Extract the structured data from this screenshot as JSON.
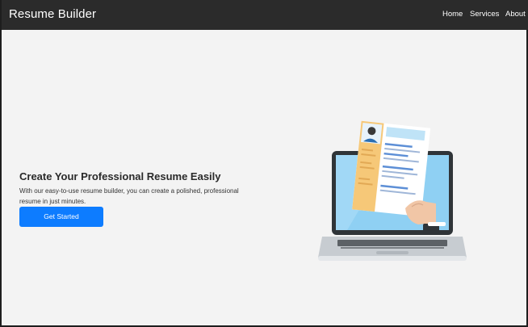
{
  "navbar": {
    "brand": "Resume Builder",
    "links": [
      {
        "label": "Home"
      },
      {
        "label": "Services"
      },
      {
        "label": "About"
      }
    ]
  },
  "hero": {
    "title": "Create Your Professional Resume Easily",
    "description": "With our easy-to-use resume builder, you can create a polished, professional resume in just minutes.",
    "cta_label": "Get Started"
  },
  "illustration": {
    "icon": "laptop-resume-illustration"
  },
  "colors": {
    "navbar_bg": "#2b2b2b",
    "page_bg": "#f3f3f3",
    "accent": "#0d7cff",
    "resume_sidebar": "#f6c878",
    "screen_blue": "#8fd0f3"
  }
}
